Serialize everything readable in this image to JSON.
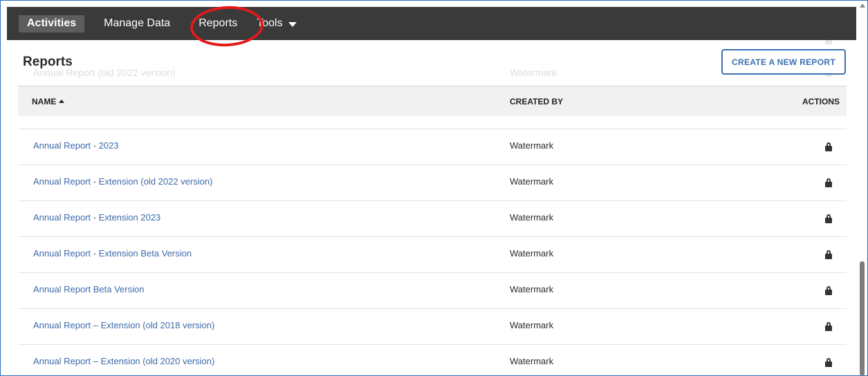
{
  "nav": {
    "items": [
      {
        "label": "Activities"
      },
      {
        "label": "Manage Data"
      },
      {
        "label": "Reports"
      },
      {
        "label": "Tools"
      }
    ]
  },
  "ghost": {
    "report_name": "Annual Report (old 2022 version)",
    "creator": "Watermark"
  },
  "page": {
    "title": "Reports",
    "create_button": "CREATE A NEW REPORT"
  },
  "table": {
    "headers": {
      "name": "NAME",
      "created_by": "CREATED BY",
      "actions": "ACTIONS"
    },
    "rows": [
      {
        "name": "Annual Report - 2023",
        "created_by": "Watermark"
      },
      {
        "name": "Annual Report - Extension (old 2022 version)",
        "created_by": "Watermark"
      },
      {
        "name": "Annual Report - Extension 2023",
        "created_by": "Watermark"
      },
      {
        "name": "Annual Report - Extension Beta Version",
        "created_by": "Watermark"
      },
      {
        "name": "Annual Report Beta Version",
        "created_by": "Watermark"
      },
      {
        "name": "Annual Report – Extension (old 2018 version)",
        "created_by": "Watermark"
      },
      {
        "name": "Annual Report – Extension (old 2020 version)",
        "created_by": "Watermark"
      }
    ]
  },
  "annotation": {
    "color": "#e11b1b",
    "target": "Reports"
  },
  "colors": {
    "nav_bg": "#3a3a3a",
    "link": "#3d6aa8",
    "accent": "#3a6fb0"
  }
}
